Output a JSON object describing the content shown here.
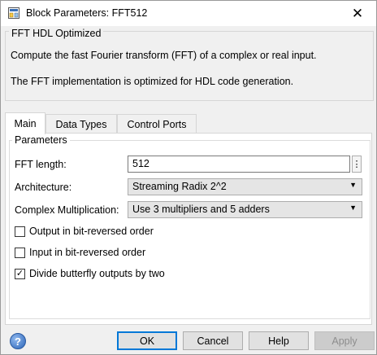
{
  "window": {
    "title": "Block Parameters: FFT512",
    "close_glyph": "✕"
  },
  "description": {
    "group_title": "FFT HDL Optimized",
    "line1": "Compute the fast Fourier transform (FFT) of a complex or real input.",
    "line2": "The FFT implementation is optimized for HDL code generation."
  },
  "tabs": [
    {
      "label": "Main",
      "active": true
    },
    {
      "label": "Data Types",
      "active": false
    },
    {
      "label": "Control Ports",
      "active": false
    }
  ],
  "parameters": {
    "group_title": "Parameters",
    "fft_length": {
      "label": "FFT length:",
      "value": "512"
    },
    "architecture": {
      "label": "Architecture:",
      "value": "Streaming Radix 2^2"
    },
    "complex_multiplication": {
      "label": "Complex Multiplication:",
      "value": "Use 3 multipliers and 5 adders"
    },
    "checkboxes": [
      {
        "label": "Output in bit-reversed order",
        "checked": false
      },
      {
        "label": "Input in bit-reversed order",
        "checked": false
      },
      {
        "label": "Divide butterfly outputs by two",
        "checked": true
      }
    ]
  },
  "buttons": {
    "ok": "OK",
    "cancel": "Cancel",
    "help": "Help",
    "apply": "Apply"
  },
  "icons": {
    "help": "help-question-icon",
    "app": "simulink-block-icon"
  },
  "colors": {
    "default_button_border": "#0078d7"
  }
}
